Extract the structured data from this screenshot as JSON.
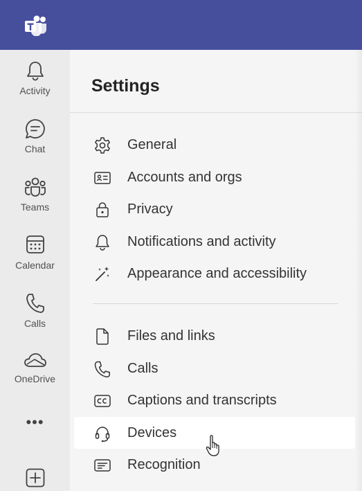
{
  "app": {
    "logo_icon": "teams-logo-icon",
    "brand_color": "#464f9c"
  },
  "rail": {
    "items": [
      {
        "label": "Activity",
        "icon": "bell-icon"
      },
      {
        "label": "Chat",
        "icon": "chat-icon"
      },
      {
        "label": "Teams",
        "icon": "teams-icon"
      },
      {
        "label": "Calendar",
        "icon": "calendar-icon"
      },
      {
        "label": "Calls",
        "icon": "phone-icon"
      },
      {
        "label": "OneDrive",
        "icon": "onedrive-icon"
      }
    ],
    "more_label": "•••",
    "add_icon": "add-apps-icon"
  },
  "settings": {
    "title": "Settings",
    "items": [
      {
        "label": "General",
        "icon": "gear-icon"
      },
      {
        "label": "Accounts and orgs",
        "icon": "id-card-icon"
      },
      {
        "label": "Privacy",
        "icon": "lock-icon"
      },
      {
        "label": "Notifications and activity",
        "icon": "bell-icon"
      },
      {
        "label": "Appearance and accessibility",
        "icon": "magic-wand-icon"
      },
      {
        "label": "Files and links",
        "icon": "file-icon"
      },
      {
        "label": "Calls",
        "icon": "phone-icon"
      },
      {
        "label": "Captions and transcripts",
        "icon": "closed-captions-icon"
      },
      {
        "label": "Devices",
        "icon": "headset-icon",
        "hovered": true
      },
      {
        "label": "Recognition",
        "icon": "recognition-icon"
      }
    ]
  }
}
